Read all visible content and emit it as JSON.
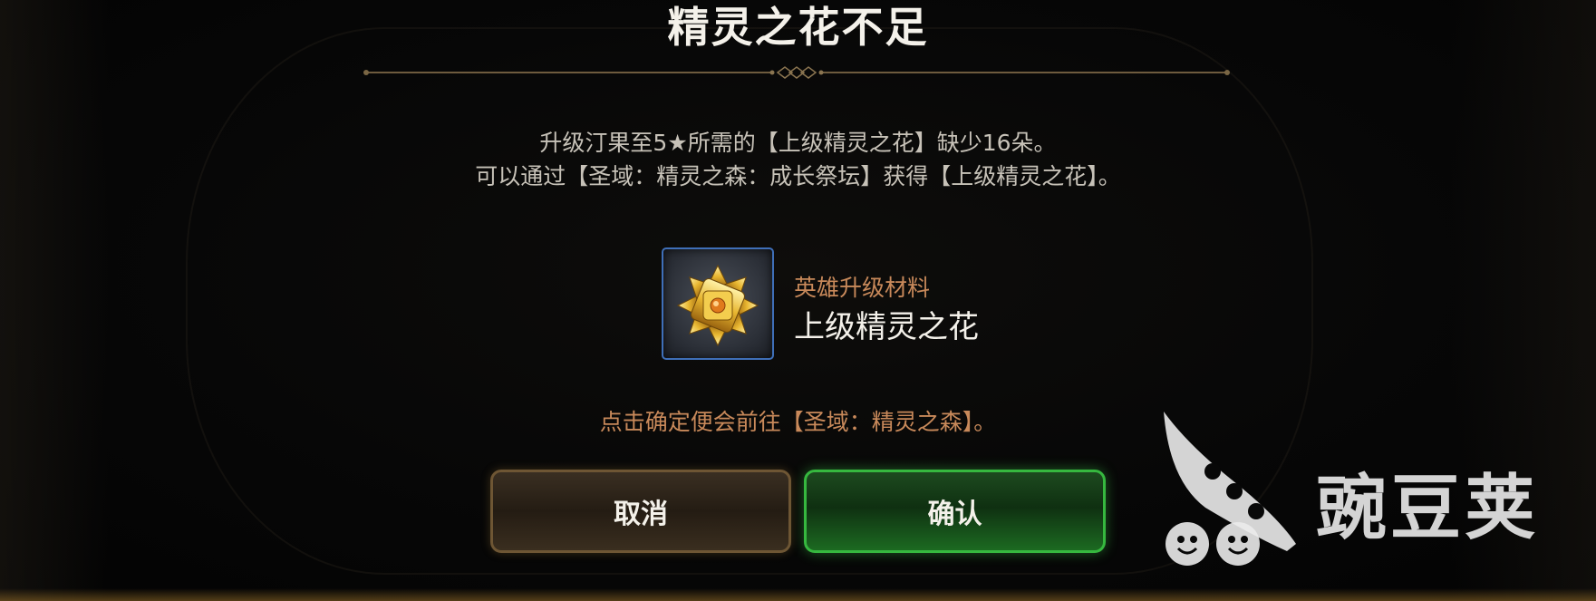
{
  "dialog": {
    "title": "精灵之花不足",
    "message_line_1": "升级汀果至5★所需的【上级精灵之花】缺少16朵。",
    "message_line_2": "可以通过【圣域：精灵之森：成长祭坛】获得【上级精灵之花】。",
    "item": {
      "category": "英雄升级材料",
      "name": "上级精灵之花",
      "icon": "golden-flower-icon"
    },
    "hint": "点击确定便会前往【圣域：精灵之森】。",
    "buttons": {
      "cancel_label": "取消",
      "confirm_label": "确认"
    }
  },
  "watermark": {
    "text": "豌豆荚",
    "icon": "pea-pod-logo"
  },
  "colors": {
    "title": "#f4f1ea",
    "accent_orange": "#c8895a",
    "confirm_green": "#36b83f",
    "cancel_border": "#6e5634",
    "icon_border": "#3f6fb8"
  }
}
